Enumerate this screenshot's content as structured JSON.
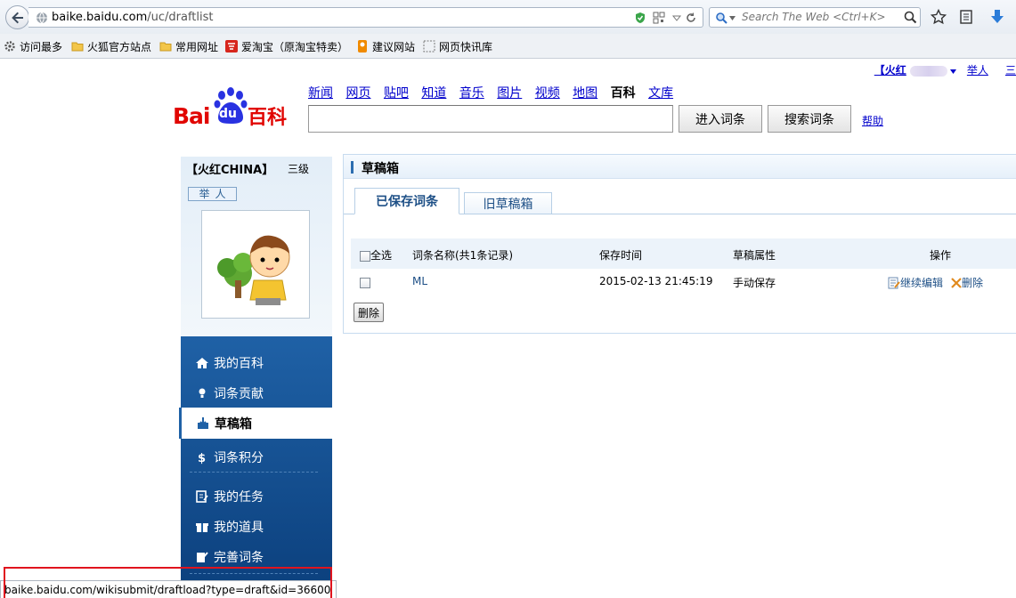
{
  "browser": {
    "url_host": "baike.baidu.com",
    "url_path": "/uc/draftlist",
    "search_placeholder": "Search The Web <Ctrl+K>",
    "bookmarks": [
      "访问最多",
      "火狐官方站点",
      "常用网址",
      "爱淘宝（原淘宝特卖）",
      "建议网站",
      "网页快讯库"
    ],
    "status_url": "baike.baidu.com/wikisubmit/draftload?type=draft&id=36600"
  },
  "header": {
    "user_link": "【火红",
    "report_link": "举人",
    "extra_link": "三",
    "logo_bai": "Bai",
    "logo_du": "du",
    "logo_baike": "百科",
    "channels": [
      "新闻",
      "网页",
      "贴吧",
      "知道",
      "音乐",
      "图片",
      "视频",
      "地图",
      "百科",
      "文库"
    ],
    "current_channel": "百科",
    "enter_button": "进入词条",
    "search_button": "搜索词条",
    "help_link": "帮助"
  },
  "sidebar": {
    "username": "【火红CHINA】",
    "level": "三级",
    "rank_badge": "举人",
    "menu": [
      {
        "label": "我的百科",
        "icon": "home-icon"
      },
      {
        "label": "词条贡献",
        "icon": "bulb-icon"
      },
      {
        "label": "草稿箱",
        "icon": "draft-icon",
        "active": true
      },
      {
        "label": "词条积分",
        "icon": "dollar-icon"
      },
      {
        "label": "我的任务",
        "icon": "task-icon"
      },
      {
        "label": "我的道具",
        "icon": "gift-icon"
      },
      {
        "label": "完善词条",
        "icon": "edit-icon"
      }
    ]
  },
  "main": {
    "title": "草稿箱",
    "tabs": [
      "已保存词条",
      "旧草稿箱"
    ],
    "active_tab": "已保存词条",
    "columns": {
      "select_all": "全选",
      "name": "词条名称(共1条记录)",
      "time": "保存时间",
      "attr": "草稿属性",
      "ops": "操作"
    },
    "rows": [
      {
        "name": "ML",
        "time": "2015-02-13 21:45:19",
        "attr": "手动保存",
        "edit": "继续编辑",
        "delete": "删除"
      }
    ],
    "delete_button": "删除"
  },
  "colors": {
    "brand_red": "#e10602",
    "sidebar_blue": "#1f61a6",
    "link_blue": "#0000cc",
    "highlight_box": "#e0141e"
  }
}
